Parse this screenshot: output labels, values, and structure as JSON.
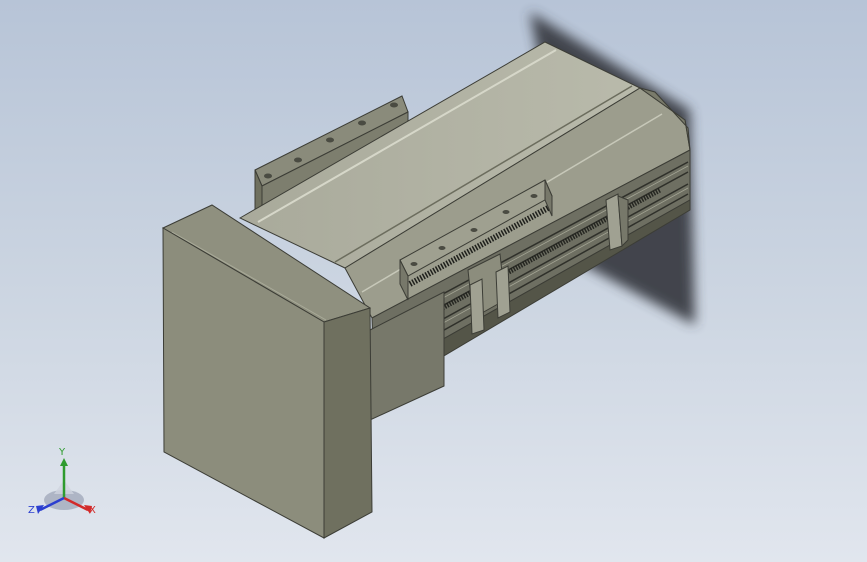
{
  "viewport": {
    "background_top": "#b7c4d7",
    "background_bottom": "#e1e6ee"
  },
  "model": {
    "body_color": "#8e8f7f",
    "shadow_color": "#3b3e44"
  },
  "triad": {
    "x_label": "X",
    "y_label": "Y",
    "z_label": "Z",
    "x_color": "#d22a2a",
    "y_color": "#2e9b2e",
    "z_color": "#2b3fd0"
  }
}
